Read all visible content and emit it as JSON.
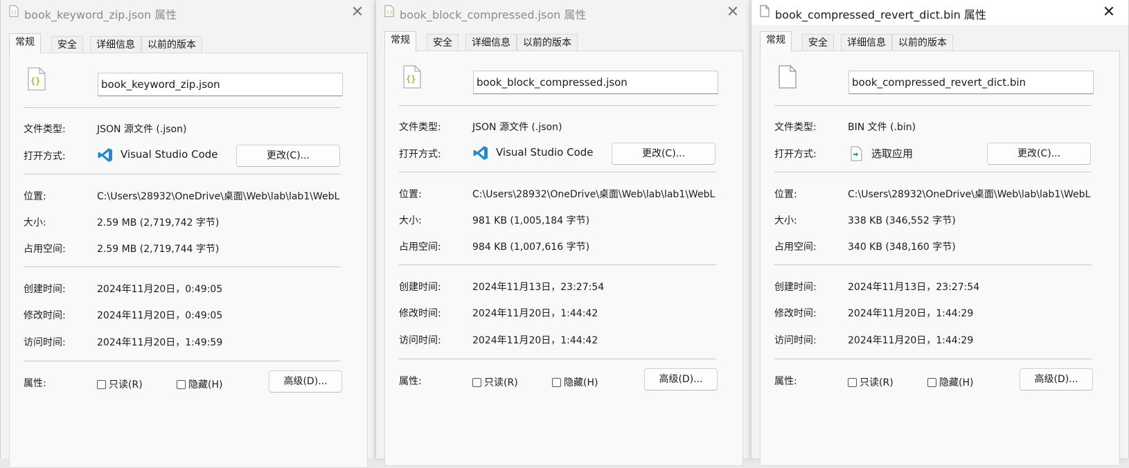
{
  "tabs": [
    "常规",
    "安全",
    "详细信息",
    "以前的版本"
  ],
  "labels": {
    "type": "文件类型:",
    "open_with": "打开方式:",
    "location": "位置:",
    "size": "大小:",
    "size_on_disk": "占用空间:",
    "created": "创建时间:",
    "modified": "修改时间:",
    "accessed": "访问时间:",
    "attributes": "属性:"
  },
  "buttons": {
    "change": "更改(C)...",
    "advanced": "高级(D)..."
  },
  "checkboxes": {
    "readonly": "只读(R)",
    "hidden": "隐藏(H)"
  },
  "colors": {
    "vscode_blue": "#1f8ad2",
    "json_icon": "#c3a93a",
    "chooser_green": "#2e9d3b"
  },
  "windows": [
    {
      "title": "book_keyword_zip.json 属性",
      "filename": "book_keyword_zip.json",
      "file_icon": "json-file-icon",
      "type": "JSON 源文件 (.json)",
      "app_icon": "vscode-icon",
      "app": "Visual Studio Code",
      "location": "C:\\Users\\28932\\OneDrive\\桌面\\Web\\lab\\lab1\\WebL",
      "size": "2.59 MB (2,719,742 字节)",
      "size_on_disk": "2.59 MB (2,719,744 字节)",
      "created": "2024年11月20日，0:49:05",
      "modified": "2024年11月20日，0:49:05",
      "accessed": "2024年11月20日，1:49:59"
    },
    {
      "title": "book_block_compressed.json 属性",
      "filename": "book_block_compressed.json",
      "file_icon": "json-file-icon",
      "type": "JSON 源文件 (.json)",
      "app_icon": "vscode-icon",
      "app": "Visual Studio Code",
      "location": "C:\\Users\\28932\\OneDrive\\桌面\\Web\\lab\\lab1\\WebL",
      "size": "981 KB (1,005,184 字节)",
      "size_on_disk": "984 KB (1,007,616 字节)",
      "created": "2024年11月13日，23:27:54",
      "modified": "2024年11月20日，1:44:42",
      "accessed": "2024年11月20日，1:44:42"
    },
    {
      "title": "book_compressed_revert_dict.bin 属性",
      "filename": "book_compressed_revert_dict.bin",
      "file_icon": "blank-file-icon",
      "type": "BIN 文件 (.bin)",
      "app_icon": "choose-app-icon",
      "app": "选取应用",
      "location": "C:\\Users\\28932\\OneDrive\\桌面\\Web\\lab\\lab1\\WebL",
      "size": "338 KB (346,552 字节)",
      "size_on_disk": "340 KB (348,160 字节)",
      "created": "2024年11月13日，23:27:54",
      "modified": "2024年11月20日，1:44:29",
      "accessed": "2024年11月20日，1:44:29"
    }
  ]
}
